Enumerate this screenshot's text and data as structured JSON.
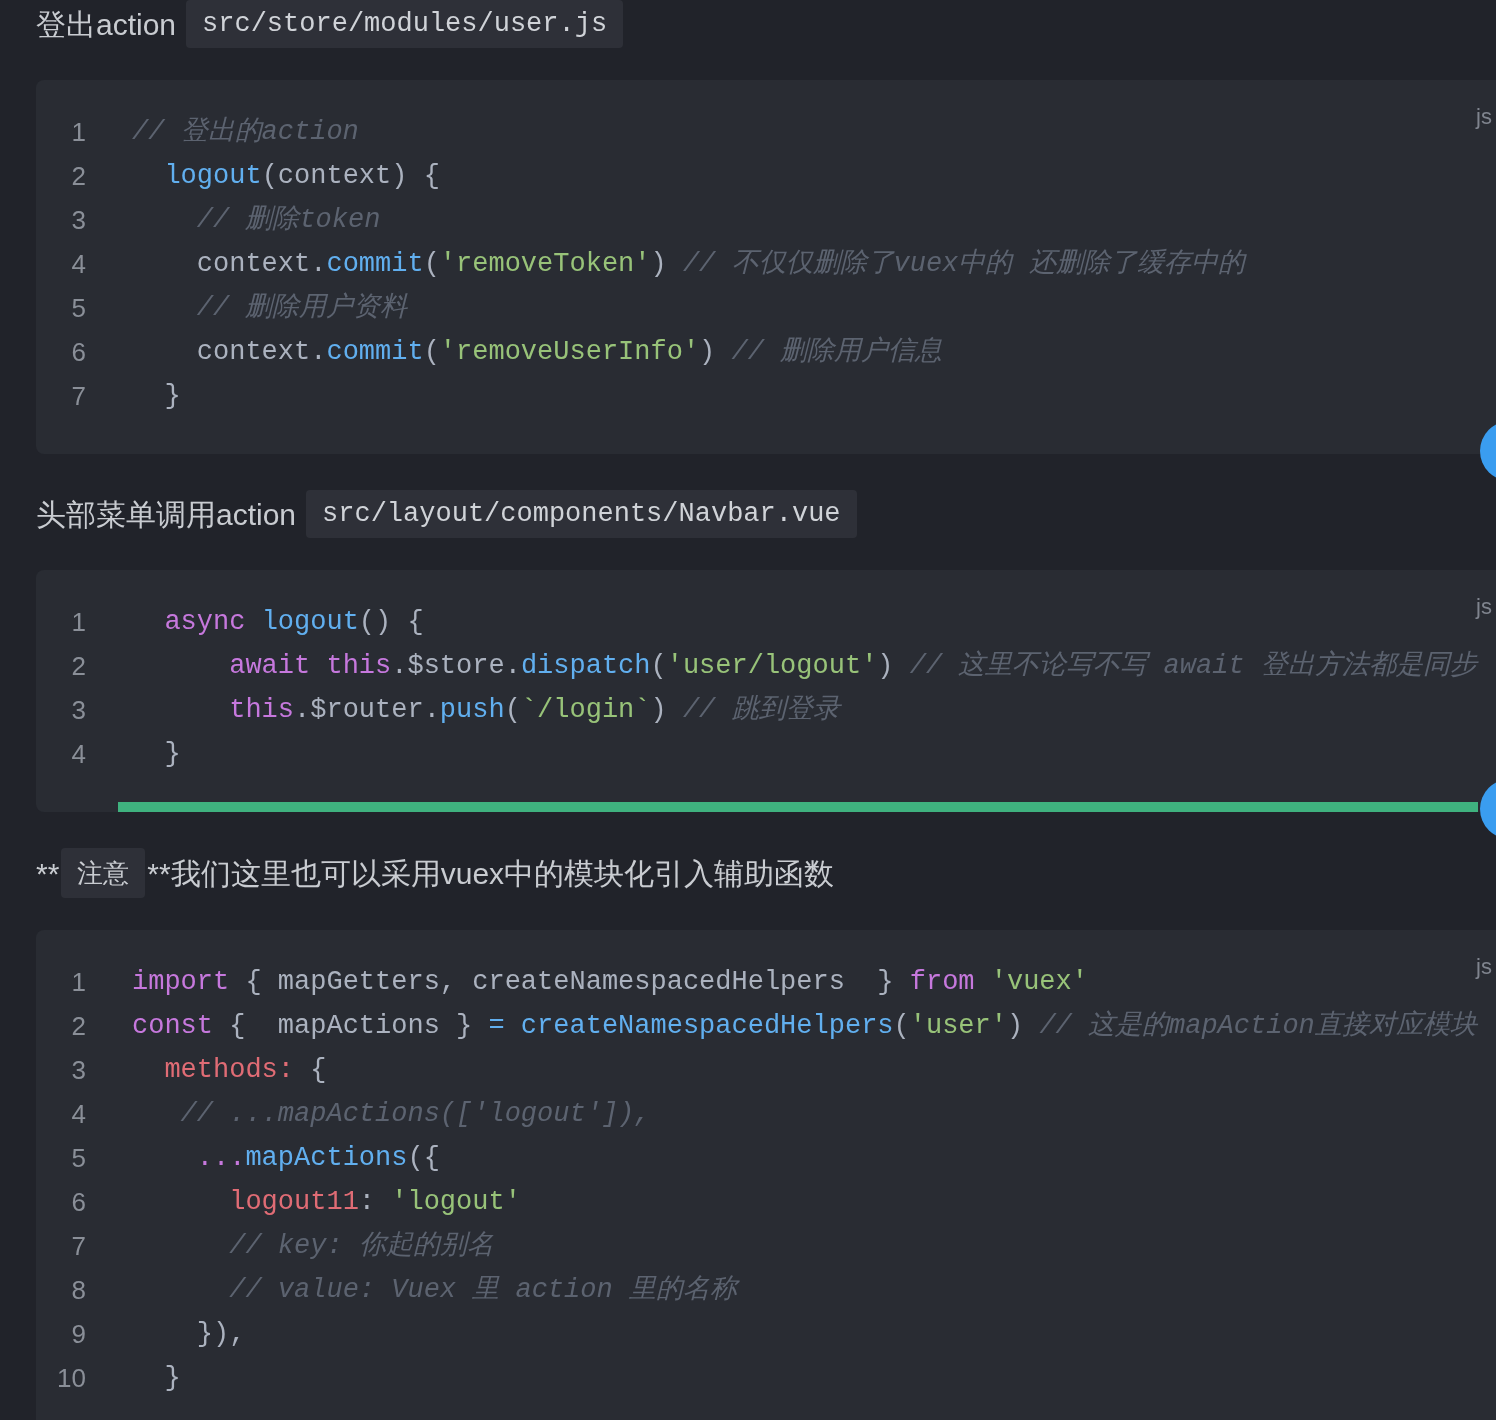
{
  "sections": [
    {
      "kind": "heading",
      "text": "登出action",
      "code": "src/store/modules/user.js"
    },
    {
      "kind": "code_block",
      "lang": "js",
      "floating_button": true,
      "scrollbar": false,
      "lines": [
        {
          "number": "1",
          "tokens": [
            {
              "kind": "comment",
              "t": "// 登出的action"
            }
          ]
        },
        {
          "number": "2",
          "tokens": [
            {
              "kind": "fn",
              "t": "  logout"
            },
            {
              "kind": "plain",
              "t": "(context) {"
            }
          ]
        },
        {
          "number": "3",
          "tokens": [
            {
              "kind": "comment",
              "t": "    // 删除token"
            }
          ]
        },
        {
          "number": "4",
          "tokens": [
            {
              "kind": "plain",
              "t": "    context."
            },
            {
              "kind": "fn",
              "t": "commit"
            },
            {
              "kind": "plain",
              "t": "("
            },
            {
              "kind": "str",
              "t": "'removeToken'"
            },
            {
              "kind": "plain",
              "t": ") "
            },
            {
              "kind": "comment",
              "t": "// 不仅仅删除了vuex中的 还删除了缓存中的"
            }
          ]
        },
        {
          "number": "5",
          "tokens": [
            {
              "kind": "comment",
              "t": "    // 删除用户资料"
            }
          ]
        },
        {
          "number": "6",
          "tokens": [
            {
              "kind": "plain",
              "t": "    context."
            },
            {
              "kind": "fn",
              "t": "commit"
            },
            {
              "kind": "plain",
              "t": "("
            },
            {
              "kind": "str",
              "t": "'removeUserInfo'"
            },
            {
              "kind": "plain",
              "t": ") "
            },
            {
              "kind": "comment",
              "t": "// 删除用户信息"
            }
          ]
        },
        {
          "number": "7",
          "tokens": [
            {
              "kind": "plain",
              "t": "  }"
            }
          ]
        }
      ]
    },
    {
      "kind": "heading",
      "text": "头部菜单调用action",
      "code": "src/layout/components/Navbar.vue"
    },
    {
      "kind": "code_block",
      "lang": "js",
      "floating_button": true,
      "scrollbar": true,
      "lines": [
        {
          "number": "1",
          "tokens": [
            {
              "kind": "kw",
              "t": "  async "
            },
            {
              "kind": "fn",
              "t": "logout"
            },
            {
              "kind": "plain",
              "t": "() {"
            }
          ]
        },
        {
          "number": "2",
          "tokens": [
            {
              "kind": "kw",
              "t": "      await this"
            },
            {
              "kind": "plain",
              "t": ".$store."
            },
            {
              "kind": "fn",
              "t": "dispatch"
            },
            {
              "kind": "plain",
              "t": "("
            },
            {
              "kind": "str",
              "t": "'user/logout'"
            },
            {
              "kind": "plain",
              "t": ") "
            },
            {
              "kind": "comment",
              "t": "// 这里不论写不写 await 登出方法都是同步"
            }
          ]
        },
        {
          "number": "3",
          "tokens": [
            {
              "kind": "kw",
              "t": "      this"
            },
            {
              "kind": "plain",
              "t": ".$router."
            },
            {
              "kind": "fn",
              "t": "push"
            },
            {
              "kind": "plain",
              "t": "("
            },
            {
              "kind": "str",
              "t": "`/login`"
            },
            {
              "kind": "plain",
              "t": ") "
            },
            {
              "kind": "comment",
              "t": "// 跳到登录"
            }
          ]
        },
        {
          "number": "4",
          "tokens": [
            {
              "kind": "plain",
              "t": "  }"
            }
          ]
        }
      ]
    },
    {
      "kind": "paragraph",
      "parts": [
        {
          "kind": "text",
          "t": "**"
        },
        {
          "kind": "code",
          "t": "注意"
        },
        {
          "kind": "text",
          "t": "**我们这里也可以采用vuex中的模块化引入辅助函数"
        }
      ]
    },
    {
      "kind": "code_block",
      "lang": "js",
      "floating_button": false,
      "scrollbar": false,
      "lines": [
        {
          "number": "1",
          "tokens": [
            {
              "kind": "kw",
              "t": "import"
            },
            {
              "kind": "plain",
              "t": " { mapGetters, createNamespacedHelpers  } "
            },
            {
              "kind": "kw",
              "t": "from"
            },
            {
              "kind": "str",
              "t": " 'vuex'"
            }
          ]
        },
        {
          "number": "2",
          "tokens": [
            {
              "kind": "kw",
              "t": "const"
            },
            {
              "kind": "plain",
              "t": " {  mapActions } "
            },
            {
              "kind": "fn",
              "t": "= createNamespacedHelpers"
            },
            {
              "kind": "plain",
              "t": "("
            },
            {
              "kind": "str",
              "t": "'user'"
            },
            {
              "kind": "plain",
              "t": ") "
            },
            {
              "kind": "comment",
              "t": "// 这是的mapAction直接对应模块"
            }
          ]
        },
        {
          "number": "3",
          "tokens": [
            {
              "kind": "prop",
              "t": "  methods:"
            },
            {
              "kind": "plain",
              "t": " {"
            }
          ]
        },
        {
          "number": "4",
          "tokens": [
            {
              "kind": "comment",
              "t": "   // ...mapActions(['logout']),"
            }
          ]
        },
        {
          "number": "5",
          "tokens": [
            {
              "kind": "kw",
              "t": "    ..."
            },
            {
              "kind": "fn",
              "t": "mapActions"
            },
            {
              "kind": "plain",
              "t": "({"
            }
          ]
        },
        {
          "number": "6",
          "tokens": [
            {
              "kind": "prop",
              "t": "      logout11"
            },
            {
              "kind": "plain",
              "t": ": "
            },
            {
              "kind": "str",
              "t": "'logout'"
            }
          ]
        },
        {
          "number": "7",
          "tokens": [
            {
              "kind": "comment",
              "t": "      // key: 你起的别名"
            }
          ]
        },
        {
          "number": "8",
          "tokens": [
            {
              "kind": "comment",
              "t": "      // value: Vuex 里 action 里的名称"
            }
          ]
        },
        {
          "number": "9",
          "tokens": [
            {
              "kind": "plain",
              "t": "    }),"
            }
          ]
        },
        {
          "number": "10",
          "tokens": [
            {
              "kind": "plain",
              "t": "  }"
            }
          ]
        }
      ]
    }
  ]
}
